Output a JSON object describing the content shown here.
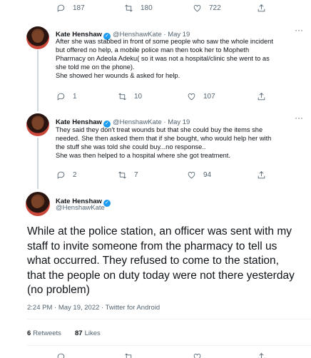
{
  "top_actions": {
    "reply": "187",
    "retweet": "180",
    "like": "722"
  },
  "tweets": [
    {
      "name": "Kate Henshaw",
      "handle": "@HenshawKate",
      "date": "May 19",
      "lines": [
        "After she was stabbed in front of  some people who saw the whole incident",
        "but offered no help, a mobile police man then took her to Mopheth",
        "Pharmacy on Adeola Adeku( so it was not a hospital/clinic she went to as",
        "she told me on the phone).",
        "She showed her wounds & asked for help."
      ],
      "reply": "1",
      "retweet": "10",
      "like": "107"
    },
    {
      "name": "Kate Henshaw",
      "handle": "@HenshawKate",
      "date": "May 19",
      "lines": [
        "They said they don't treat wounds but that she could buy the items she",
        "needed. She then asked them that if she bought, who would help her with",
        "the stuff she was told she could buy...no response..",
        "She was then helped to a hospital where she got treatment."
      ],
      "reply": "2",
      "retweet": "7",
      "like": "94"
    }
  ],
  "main_tweet": {
    "name": "Kate Henshaw",
    "handle": "@HenshawKate",
    "lines": [
      "While at the police station, an officer was sent with my",
      "staff to invite someone from the pharmacy to tell us",
      "what occurred. They refused to come to the station,",
      "that the people on duty today were not there yesterday",
      "(no problem)"
    ],
    "timestamp": "2:24 PM · May 19, 2022 · Twitter for Android",
    "retweets_count": "6",
    "retweets_label": "Retweets",
    "likes_count": "87",
    "likes_label": "Likes"
  },
  "colors": {
    "verified": "#1d9bf0",
    "muted": "#536471",
    "text": "#0f1419"
  }
}
